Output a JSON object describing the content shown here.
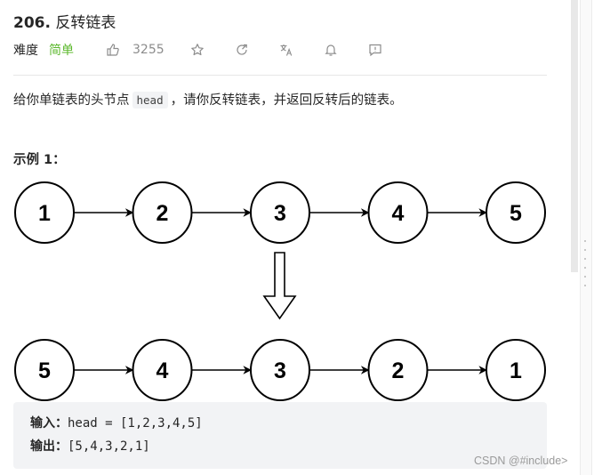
{
  "problem": {
    "number": "206.",
    "title": "反转链表"
  },
  "meta": {
    "difficulty_label": "难度",
    "difficulty_value": "简单",
    "difficulty_color": "#5cb82d",
    "likes": "3255",
    "icons": [
      "thumbs-up-icon",
      "star-icon",
      "share-icon",
      "translate-icon",
      "bell-icon",
      "feedback-icon"
    ]
  },
  "description": {
    "before": "给你单链表的头节点",
    "code": "head",
    "after": "，请你反转链表，并返回反转后的链表。"
  },
  "example": {
    "title": "示例 1：",
    "input_nodes": [
      "1",
      "2",
      "3",
      "4",
      "5"
    ],
    "output_nodes": [
      "5",
      "4",
      "3",
      "2",
      "1"
    ],
    "input_label": "输入：",
    "input_value": "head = [1,2,3,4,5]",
    "output_label": "输出：",
    "output_value": "[5,4,3,2,1]"
  },
  "watermark": "CSDN @#include>"
}
